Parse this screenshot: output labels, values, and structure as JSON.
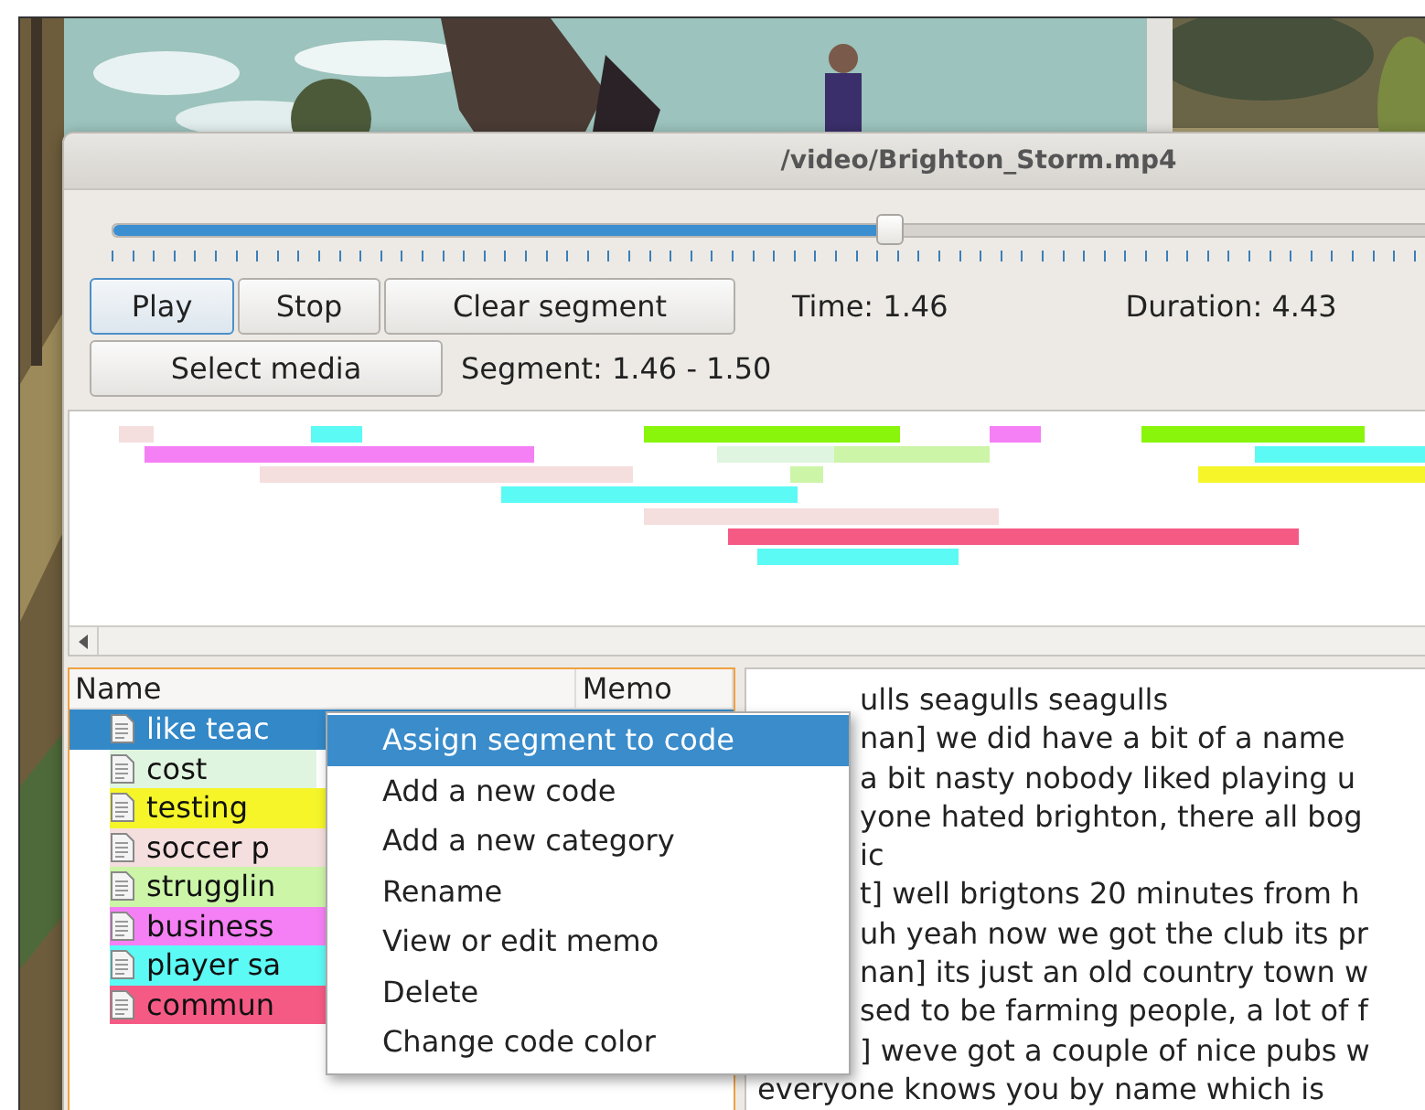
{
  "window": {
    "title": "/video/Brighton_Storm.mp4"
  },
  "position_slider": {
    "level": 0.447
  },
  "buttons": [
    {
      "label": "Play",
      "focused": true
    },
    {
      "label": "Stop",
      "focused": false
    },
    {
      "label": "Clear segment",
      "focused": false
    }
  ],
  "time_label": "Time: 1.46",
  "duration_label": "Duration: 4.43",
  "select_media_button": "Select media",
  "segment_label": "Segment: 1.46 - 1.50",
  "code_tree": {
    "columns": [
      "Name",
      "Memo"
    ],
    "items": [
      {
        "name": "like teac",
        "selected": true
      },
      {
        "name": "cost",
        "color": "#e0f5e0",
        "selected": false
      },
      {
        "name": "testing",
        "color": "#f5f52a",
        "selected": false
      },
      {
        "name": "soccer p",
        "color": "#f5dede",
        "selected": false
      },
      {
        "name": "strugglin",
        "color": "#ccf5a8",
        "selected": false
      },
      {
        "name": "business",
        "color": "#f580f5",
        "selected": false
      },
      {
        "name": "player sa",
        "color": "#5cfaf5",
        "selected": false
      },
      {
        "name": "commun",
        "color": "#f55a85",
        "selected": false
      }
    ]
  },
  "context_menu": [
    {
      "label": "Assign segment to code",
      "selected": true
    },
    {
      "label": "Add a new code",
      "selected": false
    },
    {
      "label": "Add a new category",
      "selected": false
    },
    {
      "label": "Rename",
      "selected": false
    },
    {
      "label": "View or edit memo",
      "selected": false
    },
    {
      "label": "Delete",
      "selected": false
    },
    {
      "label": "Change code color",
      "selected": false
    }
  ],
  "transcript": [
    {
      "text": "ulls seagulls seagulls",
      "covered": true
    },
    {
      "text": "nan] we did have a bit of a name",
      "covered": true
    },
    {
      "text": "a bit nasty nobody liked playing u",
      "covered": true
    },
    {
      "text": "yone hated brighton, there all bog",
      "covered": true
    },
    {
      "text": "ic",
      "covered": true
    },
    {
      "text": "t] well brigtons 20 minutes from h",
      "covered": true
    },
    {
      "text": "uh yeah now we got the club its pr",
      "covered": true
    },
    {
      "text": "nan] its just an old country town w",
      "covered": true
    },
    {
      "text": "sed to be farming people, a lot of f",
      "covered": true
    },
    {
      "text": "] weve got a couple of nice pubs w",
      "covered": true
    },
    {
      "text": "everyone knows you by name which is",
      "covered": false
    }
  ]
}
